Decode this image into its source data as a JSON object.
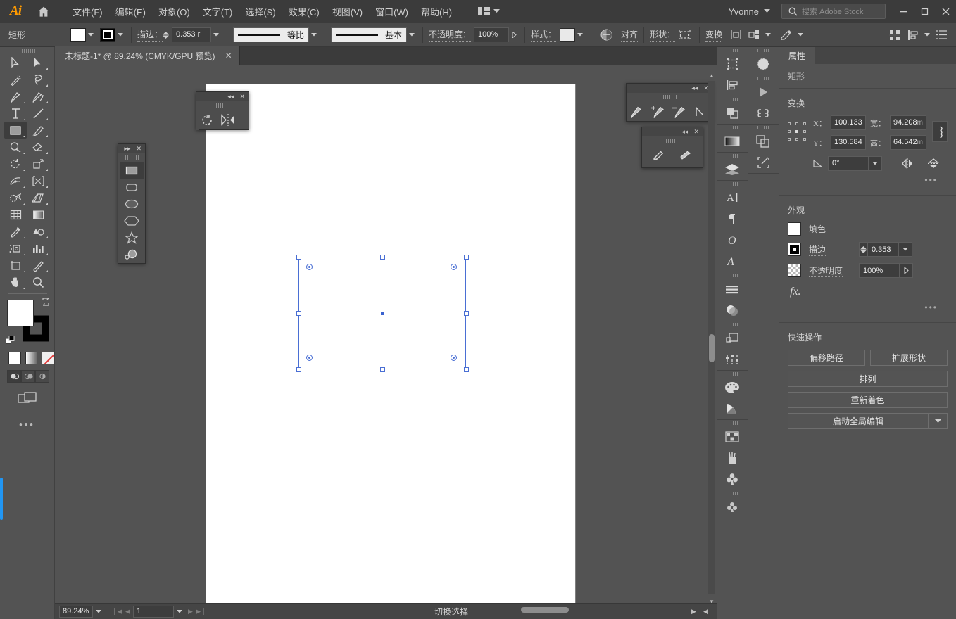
{
  "app": {
    "name": "Adobe Illustrator",
    "logo_text": "Ai",
    "user": "Yvonne"
  },
  "menubar": {
    "items": [
      {
        "label": "文件(F)",
        "name": "menu-file"
      },
      {
        "label": "编辑(E)",
        "name": "menu-edit"
      },
      {
        "label": "对象(O)",
        "name": "menu-object"
      },
      {
        "label": "文字(T)",
        "name": "menu-type"
      },
      {
        "label": "选择(S)",
        "name": "menu-select"
      },
      {
        "label": "效果(C)",
        "name": "menu-effect"
      },
      {
        "label": "视图(V)",
        "name": "menu-view"
      },
      {
        "label": "窗口(W)",
        "name": "menu-window"
      },
      {
        "label": "帮助(H)",
        "name": "menu-help"
      }
    ],
    "search_placeholder": "搜索 Adobe Stock",
    "window_buttons": {
      "minimize": "─",
      "maximize": "□",
      "close": "✕"
    }
  },
  "controlbar": {
    "object_label": "矩形",
    "stroke_label": "描边：",
    "stroke_weight": "0.353 r",
    "profile_label": "等比",
    "brush_label": "基本",
    "opacity_label": "不透明度：",
    "opacity_value": "100%",
    "style_label": "样式：",
    "align_label": "对齐",
    "shape_label": "形状：",
    "transform_label": "变换"
  },
  "tabs": {
    "document": "未标题-1* @ 89.24% (CMYK/GPU 预览)",
    "close_glyph": "✕"
  },
  "toolbar": {
    "tools": [
      {
        "name": "selection-tool",
        "label": "选择工具"
      },
      {
        "name": "direct-selection-tool",
        "label": "直接选择工具"
      },
      {
        "name": "magic-wand-tool",
        "label": "魔棒工具"
      },
      {
        "name": "lasso-tool",
        "label": "套索工具"
      },
      {
        "name": "pen-tool",
        "label": "钢笔工具"
      },
      {
        "name": "curvature-tool",
        "label": "曲率工具"
      },
      {
        "name": "type-tool",
        "label": "文字工具"
      },
      {
        "name": "line-segment-tool",
        "label": "直线段工具"
      },
      {
        "name": "rectangle-tool",
        "label": "矩形工具",
        "active": true
      },
      {
        "name": "paintbrush-tool",
        "label": "画笔工具"
      },
      {
        "name": "shaper-tool",
        "label": "Shaper 工具"
      },
      {
        "name": "eraser-tool",
        "label": "橡皮擦工具"
      },
      {
        "name": "rotate-tool",
        "label": "旋转工具"
      },
      {
        "name": "scale-tool",
        "label": "比例缩放工具"
      },
      {
        "name": "width-tool",
        "label": "宽度工具"
      },
      {
        "name": "free-transform-tool",
        "label": "自由变换工具"
      },
      {
        "name": "shape-builder-tool",
        "label": "形状生成器工具"
      },
      {
        "name": "perspective-grid-tool",
        "label": "透视网格工具"
      },
      {
        "name": "mesh-tool",
        "label": "网格工具"
      },
      {
        "name": "gradient-tool",
        "label": "渐变工具"
      },
      {
        "name": "eyedropper-tool",
        "label": "吸管工具"
      },
      {
        "name": "blend-tool",
        "label": "混合工具"
      },
      {
        "name": "symbol-sprayer-tool",
        "label": "符号喷枪工具"
      },
      {
        "name": "column-graph-tool",
        "label": "柱形图工具"
      },
      {
        "name": "artboard-tool",
        "label": "画板工具"
      },
      {
        "name": "slice-tool",
        "label": "切片工具"
      },
      {
        "name": "hand-tool",
        "label": "抓手工具"
      },
      {
        "name": "zoom-tool",
        "label": "缩放工具"
      }
    ],
    "color_controls": {
      "fill_color": "#ffffff",
      "stroke_color": "#000000",
      "modes": [
        "color-mode",
        "gradient-mode",
        "none-mode"
      ]
    },
    "more_dots": "•••"
  },
  "flyouts": {
    "shapes": {
      "name": "shapes-flyout",
      "tools": [
        {
          "name": "rectangle-tool",
          "active": true
        },
        {
          "name": "rounded-rectangle-tool"
        },
        {
          "name": "ellipse-tool"
        },
        {
          "name": "polygon-tool"
        },
        {
          "name": "star-tool"
        },
        {
          "name": "flare-tool"
        }
      ]
    },
    "rotate": {
      "name": "rotate-flyout",
      "tools": [
        {
          "name": "rotate-tool"
        },
        {
          "name": "reflect-tool"
        }
      ]
    },
    "pen": {
      "name": "pen-flyout",
      "tools": [
        {
          "name": "pen-tool"
        },
        {
          "name": "add-anchor-point-tool"
        },
        {
          "name": "delete-anchor-point-tool"
        },
        {
          "name": "anchor-point-tool"
        }
      ]
    },
    "pencil": {
      "name": "pencil-flyout",
      "tools": [
        {
          "name": "pencil-tool"
        },
        {
          "name": "smooth-tool"
        }
      ]
    }
  },
  "canvas": {
    "artboard_color": "#ffffff",
    "selection": {
      "name": "selected-rectangle",
      "stroke_color": "#4a6fd4"
    }
  },
  "icondock": {
    "column_left": [
      {
        "name": "artboards-panel-icon"
      },
      {
        "name": "align-panel-icon"
      },
      {
        "name": "pathfinder-panel-icon"
      },
      {
        "name": "gradient-panel-icon"
      },
      {
        "name": "layers-panel-icon"
      },
      {
        "name": "character-panel-icon"
      },
      {
        "name": "paragraph-panel-icon"
      },
      {
        "name": "opentype-panel-icon"
      },
      {
        "name": "glyphs-panel-icon"
      },
      {
        "name": "stroke-panel-icon"
      },
      {
        "name": "transparency-panel-icon"
      },
      {
        "name": "appearance-panel-icon"
      },
      {
        "name": "graphic-styles-panel-icon"
      },
      {
        "name": "color-panel-icon"
      },
      {
        "name": "color-guide-panel-icon"
      },
      {
        "name": "swatches-panel-icon"
      },
      {
        "name": "brushes-panel-icon"
      },
      {
        "name": "symbols-panel-icon"
      },
      {
        "name": "libraries-panel-icon"
      }
    ],
    "column_right": [
      {
        "name": "asset-export-panel-icon"
      },
      {
        "name": "actions-panel-icon"
      },
      {
        "name": "links-panel-icon"
      },
      {
        "name": "document-info-panel-icon"
      },
      {
        "name": "artboard-export-panel-icon"
      }
    ]
  },
  "properties": {
    "tab_label": "属性",
    "object_type": "矩形",
    "transform": {
      "section_title": "变换",
      "x_label": "X：",
      "x_value": "100.133",
      "y_label": "Y：",
      "y_value": "130.584",
      "w_label": "宽：",
      "w_value": "94.208",
      "w_unit": "m",
      "h_label": "高：",
      "h_value": "64.542",
      "h_unit": "m",
      "angle_label": "∠",
      "angle_value": "0°",
      "link_icon": "link-proportions-icon",
      "flip_h_icon": "flip-horizontal-icon",
      "flip_v_icon": "flip-vertical-icon",
      "more_dots": "•••"
    },
    "appearance": {
      "section_title": "外观",
      "fill_label": "填色",
      "stroke_label": "描边",
      "stroke_value": "0.353",
      "opacity_label": "不透明度",
      "opacity_value": "100%",
      "fx_label": "fx.",
      "more_dots": "•••"
    },
    "quick_actions": {
      "section_title": "快速操作",
      "buttons": [
        {
          "label": "偏移路径",
          "name": "offset-path-button"
        },
        {
          "label": "扩展形状",
          "name": "expand-shape-button"
        },
        {
          "label": "排列",
          "name": "arrange-button"
        },
        {
          "label": "重新着色",
          "name": "recolor-button"
        },
        {
          "label": "启动全局编辑",
          "name": "start-global-edit-button"
        }
      ]
    }
  },
  "statusbar": {
    "zoom_value": "89.24%",
    "page_value": "1",
    "status_text": "切换选择",
    "nav_first": "❙◀",
    "nav_prev": "◀",
    "nav_next": "▶",
    "nav_last": "▶❙"
  },
  "colors": {
    "chrome_bg": "#535353",
    "menubar_bg": "#3b3b3b",
    "controlbar_bg": "#4a4a4a",
    "accent_selection": "#4a6fd4",
    "scroll_highlight": "#2196f3"
  }
}
